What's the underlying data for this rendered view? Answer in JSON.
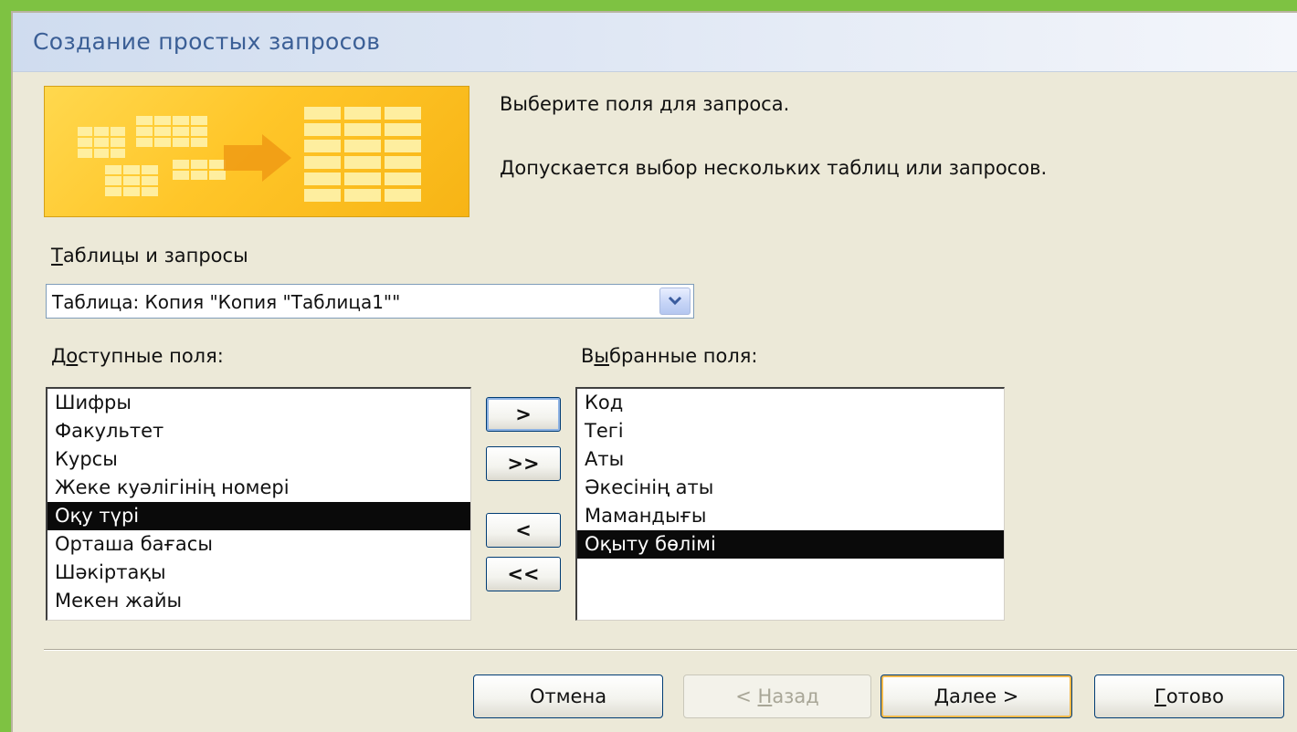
{
  "window": {
    "title": "Создание простых запросов"
  },
  "instructions": {
    "line1": "Выберите поля для запроса.",
    "line2": "Допускается выбор нескольких таблиц или запросов."
  },
  "tables_queries": {
    "label_accel": "Т",
    "label_rest": "аблицы и запросы",
    "selected_value": "Таблица: Копия \"Копия \"Таблица1\"\""
  },
  "available_fields": {
    "label_pre": "Д",
    "label_accel": "о",
    "label_rest": "ступные поля:",
    "items": [
      "Шифры",
      "Факультет",
      "Курсы",
      "Жеке куәлігінің номері",
      "Оқу түрі",
      "Орташа бағасы",
      "Шәкіртақы",
      "Мекен жайы"
    ],
    "selected_index": 4
  },
  "selected_fields": {
    "label_pre": "В",
    "label_accel": "ы",
    "label_rest": "бранные поля:",
    "items": [
      "Код",
      "Тегі",
      "Аты",
      "Әкесінің аты",
      "Мамандығы",
      "Оқыту бөлімі"
    ],
    "selected_index": 5
  },
  "move_buttons": {
    "add_one": ">",
    "add_all": ">>",
    "remove_one": "<",
    "remove_all": "<<"
  },
  "actions": {
    "cancel": "Отмена",
    "back_pre": "< ",
    "back_accel": "Н",
    "back_rest": "азад",
    "next_accel": "Д",
    "next_rest": "алее >",
    "finish_accel": "Г",
    "finish_rest": "отово"
  }
}
